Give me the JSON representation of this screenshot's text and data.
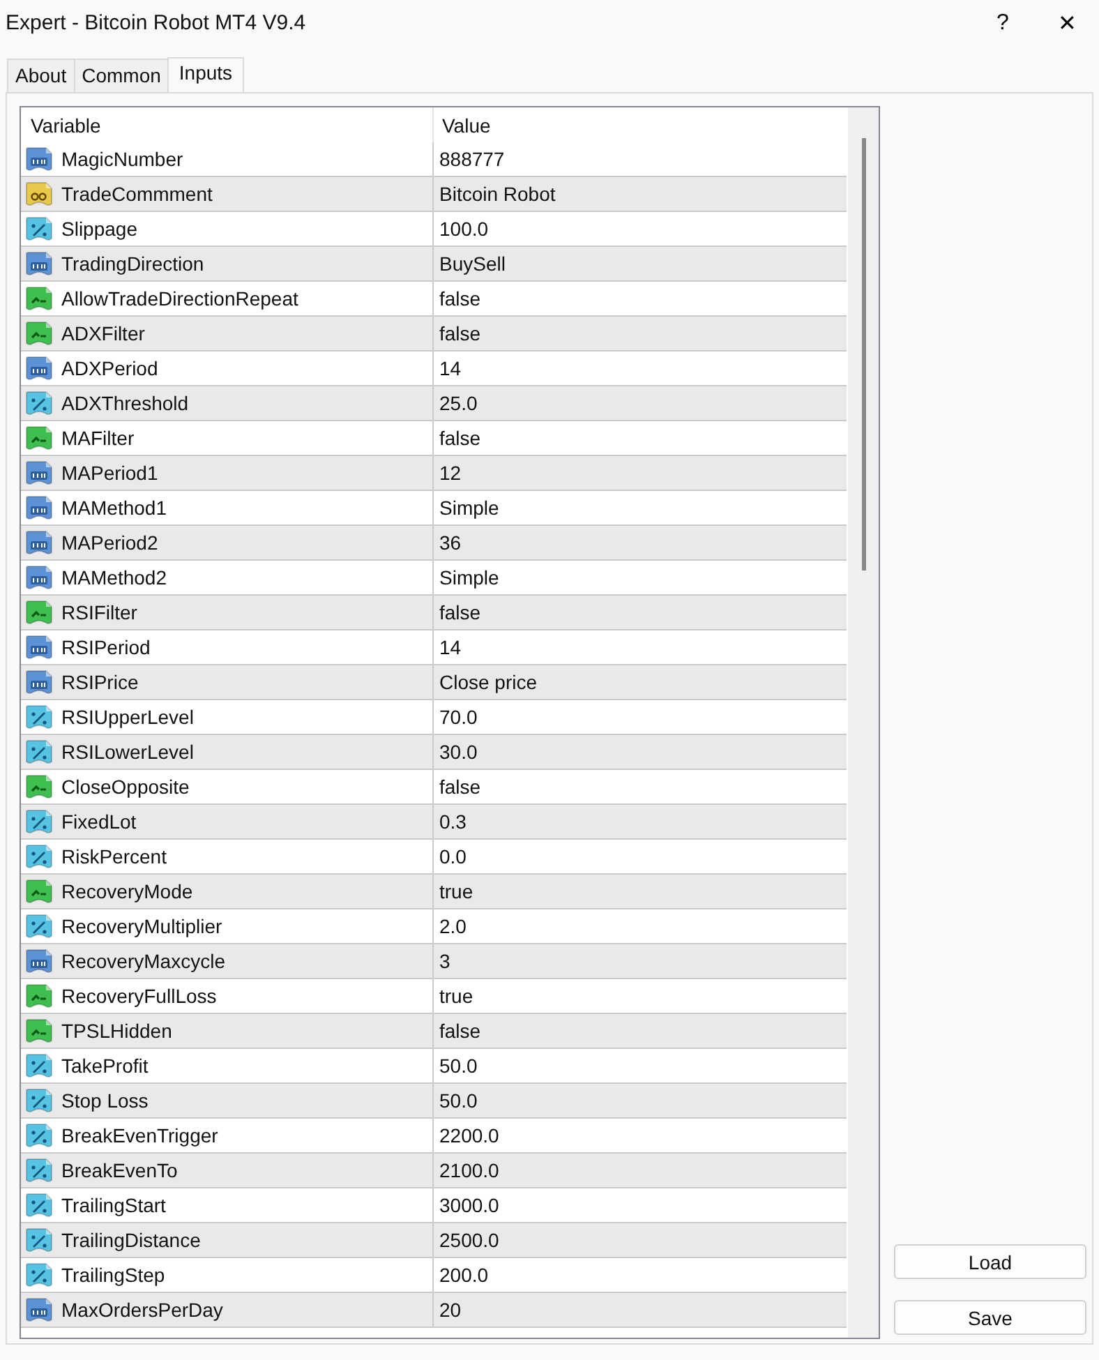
{
  "window": {
    "title": "Expert - Bitcoin Robot MT4 V9.4",
    "help": "?",
    "close": "✕"
  },
  "tabs": [
    {
      "label": "About",
      "selected": false
    },
    {
      "label": "Common",
      "selected": false
    },
    {
      "label": "Inputs",
      "selected": true
    }
  ],
  "table": {
    "columns": [
      "Variable",
      "Value"
    ],
    "rows": [
      {
        "kind": "int",
        "name": "MagicNumber",
        "value": "888777"
      },
      {
        "kind": "string",
        "name": "TradeCommment",
        "value": "Bitcoin Robot"
      },
      {
        "kind": "double",
        "name": "Slippage",
        "value": "100.0"
      },
      {
        "kind": "int",
        "name": "TradingDirection",
        "value": "BuySell"
      },
      {
        "kind": "bool",
        "name": "AllowTradeDirectionRepeat",
        "value": "false"
      },
      {
        "kind": "bool",
        "name": "ADXFilter",
        "value": "false"
      },
      {
        "kind": "int",
        "name": "ADXPeriod",
        "value": "14"
      },
      {
        "kind": "double",
        "name": "ADXThreshold",
        "value": "25.0"
      },
      {
        "kind": "bool",
        "name": "MAFilter",
        "value": "false"
      },
      {
        "kind": "int",
        "name": "MAPeriod1",
        "value": "12"
      },
      {
        "kind": "int",
        "name": "MAMethod1",
        "value": "Simple"
      },
      {
        "kind": "int",
        "name": "MAPeriod2",
        "value": "36"
      },
      {
        "kind": "int",
        "name": "MAMethod2",
        "value": "Simple"
      },
      {
        "kind": "bool",
        "name": "RSIFilter",
        "value": "false"
      },
      {
        "kind": "int",
        "name": "RSIPeriod",
        "value": "14"
      },
      {
        "kind": "int",
        "name": "RSIPrice",
        "value": "Close price"
      },
      {
        "kind": "double",
        "name": "RSIUpperLevel",
        "value": "70.0"
      },
      {
        "kind": "double",
        "name": "RSILowerLevel",
        "value": "30.0"
      },
      {
        "kind": "bool",
        "name": "CloseOpposite",
        "value": "false"
      },
      {
        "kind": "double",
        "name": "FixedLot",
        "value": "0.3"
      },
      {
        "kind": "double",
        "name": "RiskPercent",
        "value": "0.0"
      },
      {
        "kind": "bool",
        "name": "RecoveryMode",
        "value": "true"
      },
      {
        "kind": "double",
        "name": "RecoveryMultiplier",
        "value": "2.0"
      },
      {
        "kind": "int",
        "name": "RecoveryMaxcycle",
        "value": "3"
      },
      {
        "kind": "bool",
        "name": "RecoveryFullLoss",
        "value": "true"
      },
      {
        "kind": "bool",
        "name": "TPSLHidden",
        "value": "false"
      },
      {
        "kind": "double",
        "name": "TakeProfit",
        "value": "50.0"
      },
      {
        "kind": "double",
        "name": "Stop Loss",
        "value": "50.0"
      },
      {
        "kind": "double",
        "name": "BreakEvenTrigger",
        "value": "2200.0"
      },
      {
        "kind": "double",
        "name": "BreakEvenTo",
        "value": "2100.0"
      },
      {
        "kind": "double",
        "name": "TrailingStart",
        "value": "3000.0"
      },
      {
        "kind": "double",
        "name": "TrailingDistance",
        "value": "2500.0"
      },
      {
        "kind": "double",
        "name": "TrailingStep",
        "value": "200.0"
      },
      {
        "kind": "int",
        "name": "MaxOrdersPerDay",
        "value": "20"
      }
    ]
  },
  "buttons": [
    "Load",
    "Save"
  ]
}
